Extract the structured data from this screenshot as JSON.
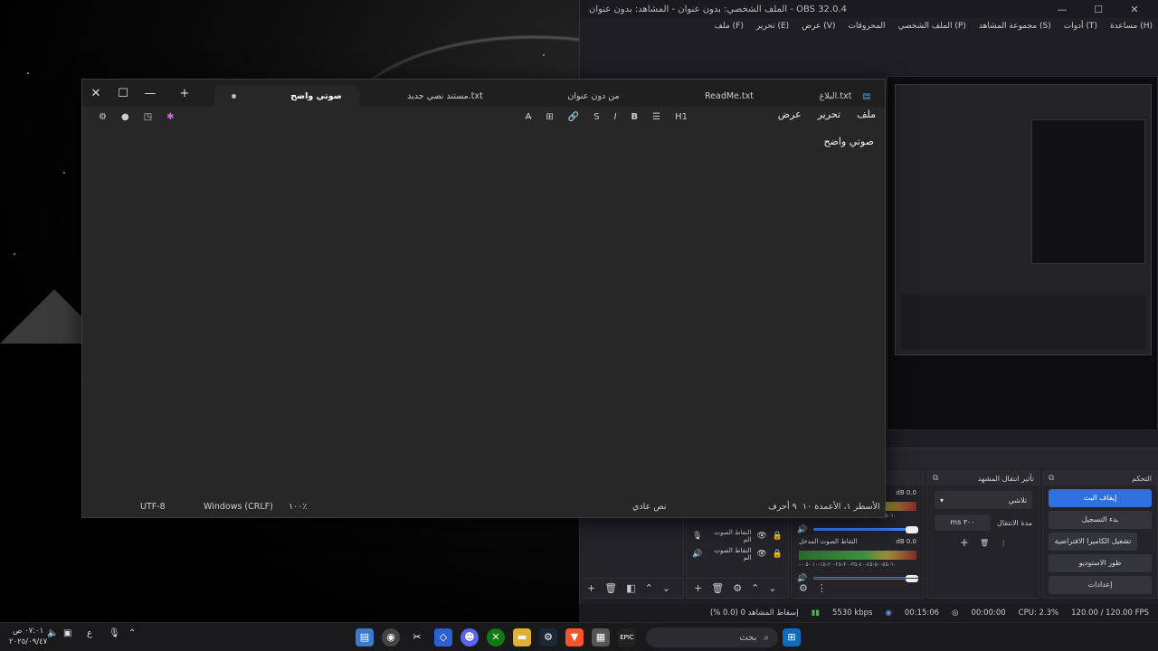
{
  "obs": {
    "title": "الملف الشخصي: بدون عنوان - المشاهد: بدون عنوان - OBS 32.0.4",
    "window_controls": [
      "—",
      "☐",
      "✕"
    ],
    "menu": [
      "ملف (F)",
      "تحرير (E)",
      "عرض (V)",
      "المحروقات",
      "الملف الشخصي (P)",
      "مجموعة المشاهد (S)",
      "أدوات (T)",
      "مساعدة (H)"
    ],
    "controls_dock": {
      "title": "التحكم",
      "buttons": [
        "إيقاف البث",
        "بدء التسجيل",
        "تشغيل الكاميرا الافتراضية",
        "طور الاستوديو",
        "إعدادات"
      ]
    },
    "transitions_dock": {
      "title": "تأثير انتقال المشهد",
      "selected": "تلاشي",
      "duration_label": "مدة الانتقال",
      "duration_value": "٣٠٠ ms"
    },
    "mixer": {
      "tracks": [
        {
          "name": "التقاط الصوت المخرج",
          "db": "0.0 dB"
        },
        {
          "name": "التقاط الصوت المدخل",
          "db": "0.0 dB"
        }
      ],
      "scale": "-٦٠-٥٥-٥٠-٤٥-٤٠-٣٥-٣٠-٢٥-٢٠-١٥-١٠ -٥ ٠"
    },
    "sources": [
      "التقاط الصوت الم",
      "التقاط الصوت الم"
    ],
    "status": {
      "fps": "120.00 / 120.00 FPS",
      "cpu": "CPU: 2.3%",
      "rec": "00:00:00",
      "stream": "00:15:06",
      "bitrate": "5530 kbps",
      "dropped": "إسقاط المشاهد 0 (0.0 %)"
    }
  },
  "notepad": {
    "tabs": [
      "البلاغ.txt",
      "ReadMe.txt",
      "من دون عنوان",
      "مستند نصي جديد.txt",
      "صوتي واضح"
    ],
    "menu": [
      "ملف",
      "تحرير",
      "عرض"
    ],
    "toolbar": [
      "H1",
      "☰",
      "B",
      "I",
      "S",
      "🔗",
      "⊞",
      "A̶"
    ],
    "content": "صوتي واضح",
    "status": {
      "position": "الأسطر ١، الأعمدة ١٠",
      "chars": "٩ أحرف",
      "format": "نص عادي",
      "zoom": "١٠٠٪",
      "line_ending": "Windows (CRLF)",
      "encoding": "UTF-8"
    }
  },
  "taskbar": {
    "search_placeholder": "بحث",
    "clock_time": "٠٧:٠١ ص",
    "clock_date": "٢٠٢٥/٠٩/٤٧",
    "lang": "ع"
  }
}
